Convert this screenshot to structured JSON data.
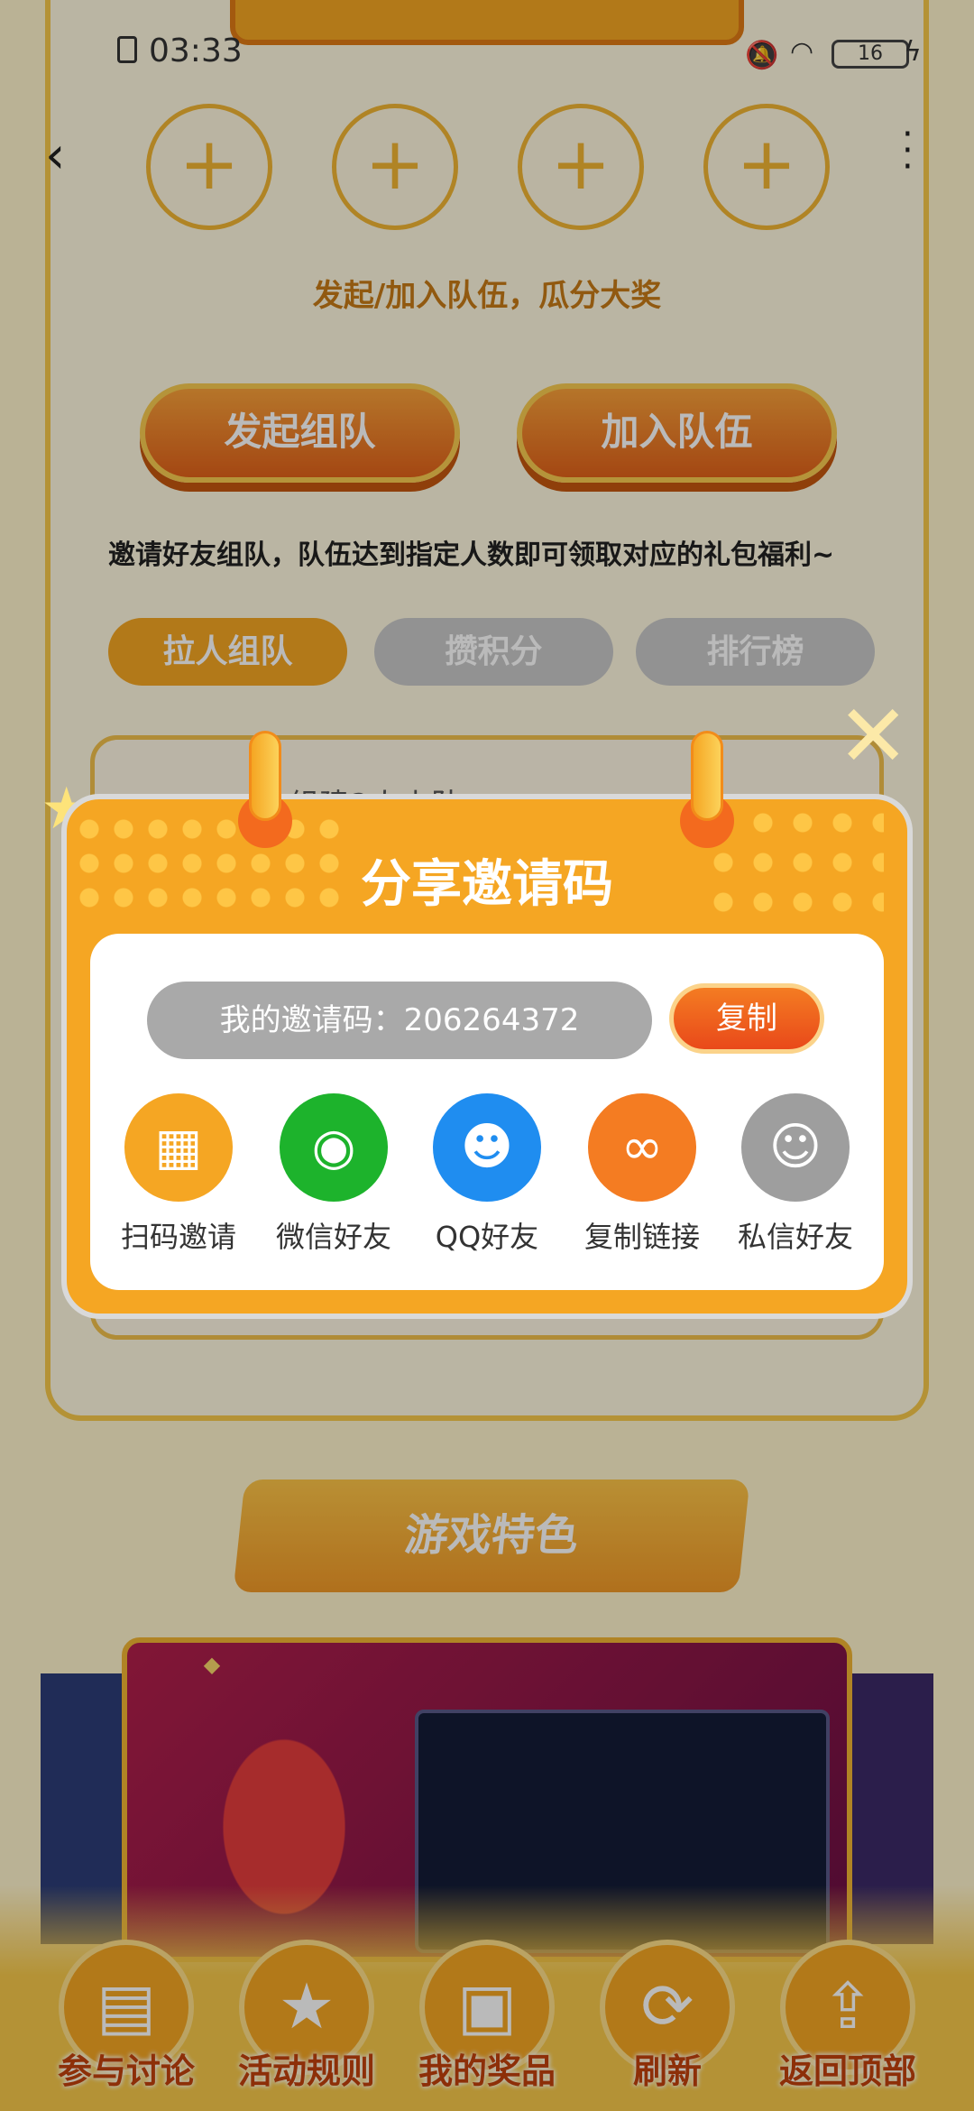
{
  "status_bar": {
    "time": "03:33",
    "battery": "16"
  },
  "team": {
    "hint": "发起/加入队伍，瓜分大奖",
    "start_button": "发起组队",
    "join_button": "加入队伍",
    "description": "邀请好友组队，队伍达到指定人数即可领取对应的礼包福利~",
    "tabs": [
      {
        "label": "拉人组队"
      },
      {
        "label": "攒积分"
      },
      {
        "label": "排行榜"
      }
    ],
    "card_label": "组建2人小队"
  },
  "section": {
    "title": "游戏特色"
  },
  "bottom_nav": [
    {
      "label": "参与讨论",
      "icon": "chat-icon"
    },
    {
      "label": "活动规则",
      "icon": "rules-icon"
    },
    {
      "label": "我的奖品",
      "icon": "gift-icon"
    },
    {
      "label": "刷新",
      "icon": "refresh-icon"
    },
    {
      "label": "返回顶部",
      "icon": "back-to-top-icon"
    }
  ],
  "dialog": {
    "title": "分享邀请码",
    "invite_code_text": "我的邀请码：206264372",
    "copy_button": "复制",
    "share_options": [
      {
        "label": "扫码邀请",
        "icon": "qr-code-icon",
        "color": "#F5A623"
      },
      {
        "label": "微信好友",
        "icon": "wechat-icon",
        "color": "#1DB32C"
      },
      {
        "label": "QQ好友",
        "icon": "qq-icon",
        "color": "#1F8DF0"
      },
      {
        "label": "复制链接",
        "icon": "link-icon",
        "color": "#F47C22"
      },
      {
        "label": "私信好友",
        "icon": "contacts-icon",
        "color": "#9E9E9E"
      }
    ]
  },
  "colors": {
    "accent": "#F5A623",
    "overlay": "rgba(0,0,0,0.27)"
  }
}
